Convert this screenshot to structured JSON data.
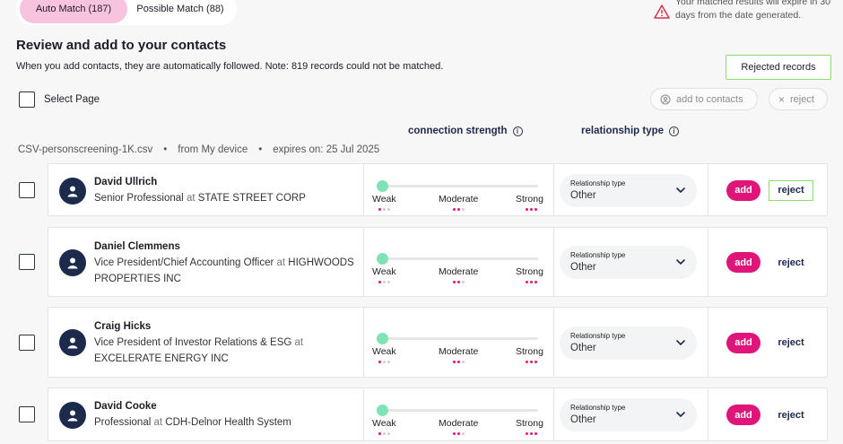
{
  "tabs": {
    "auto_match": "Auto Match (187)",
    "possible_match": "Possible Match (88)"
  },
  "warning": {
    "text": "Your matched results will expire in 30 days from the date generated.",
    "icon": "warning-triangle-icon"
  },
  "header": {
    "title": "Review and add to your contacts",
    "subtitle": "When you add contacts, they are automatically followed. Note: 819 records could not be matched.",
    "rejected_records": "Rejected records"
  },
  "toolbar": {
    "select_page": "Select Page",
    "add_to_contacts": "add to contacts",
    "reject": "reject"
  },
  "columns": {
    "connection_strength": "connection strength",
    "relationship_type": "relationship type"
  },
  "file": {
    "name": "CSV-personscreening-1K.csv",
    "source": "from My device",
    "expires": "expires on: 25 Jul 2025",
    "separator": "•"
  },
  "strength_labels": {
    "weak": "Weak",
    "moderate": "Moderate",
    "strong": "Strong"
  },
  "reltype_caption": "Relationship type",
  "contacts": [
    {
      "name": "David Ullrich",
      "title": "Senior Professional",
      "at": "at",
      "company": "STATE STREET CORP",
      "relationship": "Other",
      "strength": 0.0,
      "add": "add",
      "reject": "reject"
    },
    {
      "name": "Daniel Clemmens",
      "title": "Vice President/Chief Accounting Officer",
      "at": "at",
      "company": "HIGHWOODS PROPERTIES INC",
      "relationship": "Other",
      "strength": 0.0,
      "add": "add",
      "reject": "reject"
    },
    {
      "name": "Craig Hicks",
      "title": "Vice President of Investor Relations & ESG",
      "at": "at",
      "company": "EXCELERATE ENERGY INC",
      "relationship": "Other",
      "strength": 0.0,
      "add": "add",
      "reject": "reject"
    },
    {
      "name": "David Cooke",
      "title": "Professional",
      "at": "at",
      "company": "CDH-Delnor Health System",
      "relationship": "Other",
      "strength": 0.0,
      "add": "add",
      "reject": "reject"
    }
  ],
  "colors": {
    "accent_pink": "#e0157a",
    "tab_active": "#f8c3dd",
    "highlight_green": "#8fde6a",
    "knob_green": "#7fe3b5",
    "avatar_navy": "#1c2a4b"
  }
}
